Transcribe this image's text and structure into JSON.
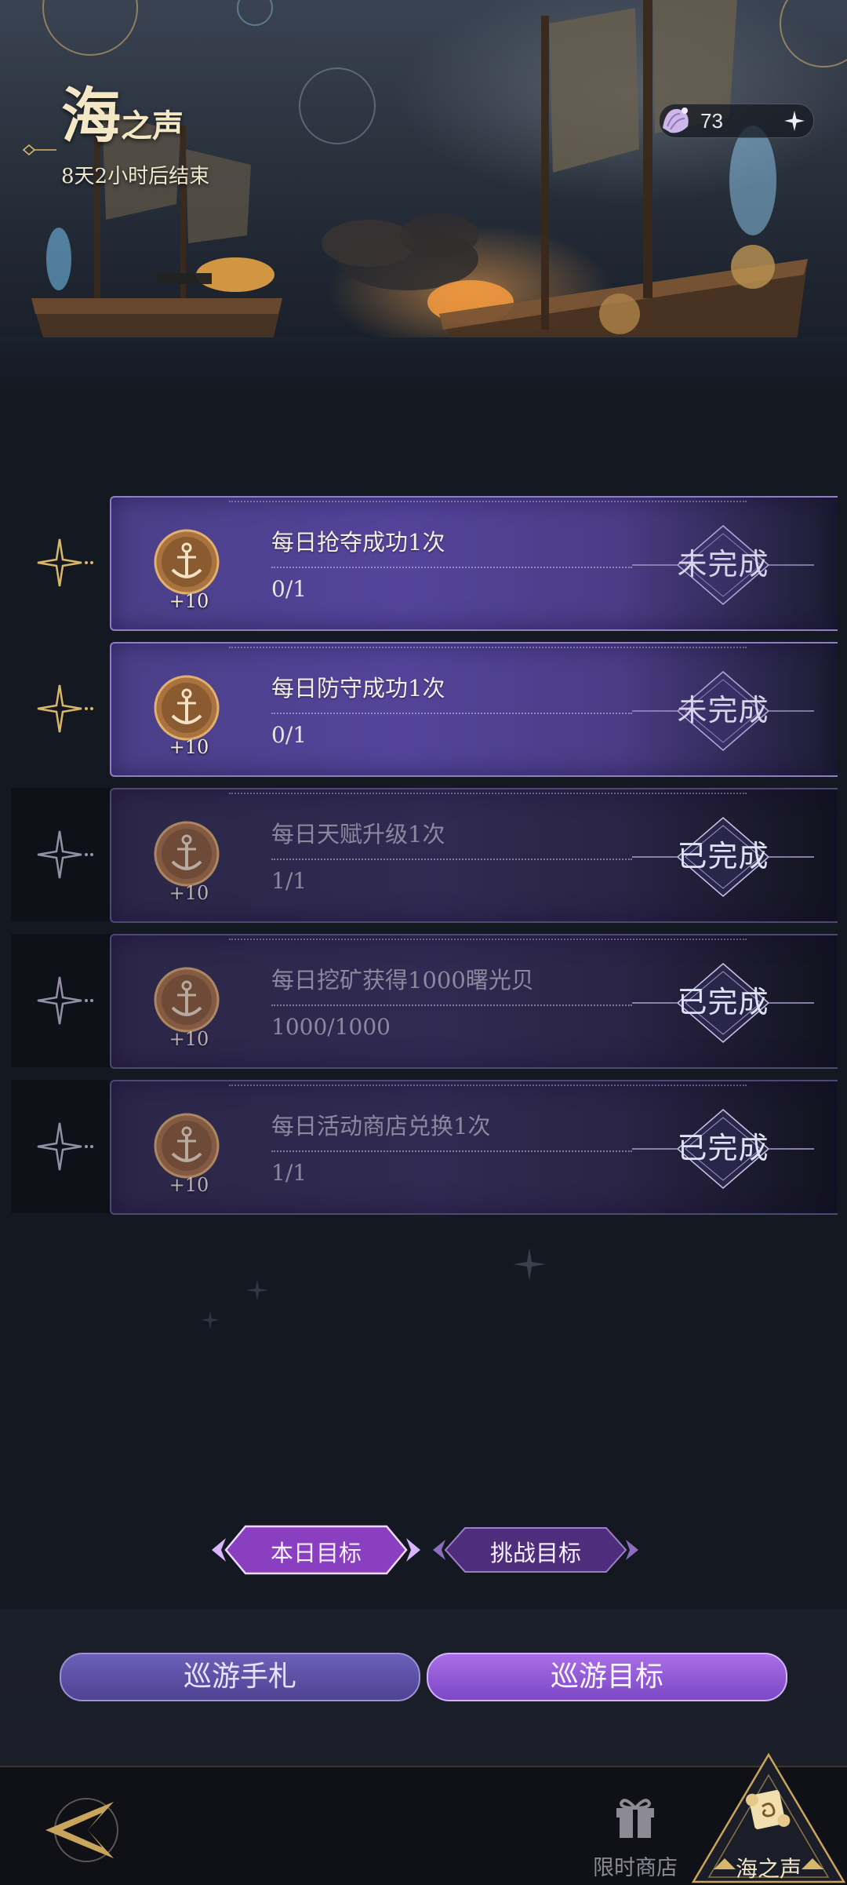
{
  "header": {
    "title_big": "海",
    "title_small": "之声",
    "countdown": "8天2小时后结束",
    "currency_value": "73"
  },
  "tasks": [
    {
      "title": "每日抢夺成功1次",
      "progress": "0/1",
      "reward": "+10",
      "status": "未完成",
      "completed": false
    },
    {
      "title": "每日防守成功1次",
      "progress": "0/1",
      "reward": "+10",
      "status": "未完成",
      "completed": false
    },
    {
      "title": "每日天赋升级1次",
      "progress": "1/1",
      "reward": "+10",
      "status": "已完成",
      "completed": true
    },
    {
      "title": "每日挖矿获得1000曙光贝",
      "progress": "1000/1000",
      "reward": "+10",
      "status": "已完成",
      "completed": true
    },
    {
      "title": "每日活动商店兑换1次",
      "progress": "1/1",
      "reward": "+10",
      "status": "已完成",
      "completed": true
    }
  ],
  "tabs": {
    "today": "本日目标",
    "challenge": "挑战目标",
    "selected": "today"
  },
  "footer_buttons": {
    "journal": "巡游手札",
    "goals": "巡游目标",
    "selected": "goals"
  },
  "bottom_nav": {
    "shop_label": "限时商店",
    "voice_label": "海之声"
  },
  "colors": {
    "card_active": "#53449a",
    "card_done": "#302a52",
    "accent_gold": "#d8b66a",
    "accent_purple": "#a86ee6"
  }
}
